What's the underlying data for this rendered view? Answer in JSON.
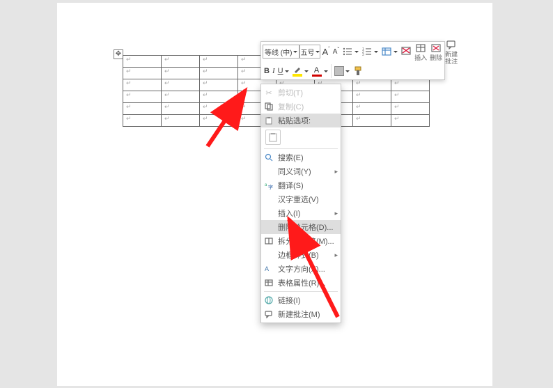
{
  "mini_toolbar": {
    "font_name": "等线 (中)",
    "font_size": "五号",
    "insert": "插入",
    "delete": "删除",
    "new_comment_l1": "新建",
    "new_comment_l2": "批注",
    "bold": "B",
    "italic": "I"
  },
  "context_menu": {
    "cut": "剪切(T)",
    "copy": "复制(C)",
    "paste_options_label": "粘贴选项:",
    "search": "搜索(E)",
    "synonyms": "同义词(Y)",
    "translate": "翻译(S)",
    "reconvert": "汉字重选(V)",
    "insert": "插入(I)",
    "delete_cells": "删除单元格(D)...",
    "split_cells": "拆分单元格(M)...",
    "border_styles": "边框样式(B)",
    "text_direction": "文字方向(X)...",
    "table_properties": "表格属性(R)...",
    "hyperlink": "链接(I)",
    "new_comment": "新建批注(M)"
  },
  "chart_data": {
    "type": "table",
    "rows": 6,
    "cols": 8,
    "note": "All cells empty (paragraph mark only)"
  }
}
